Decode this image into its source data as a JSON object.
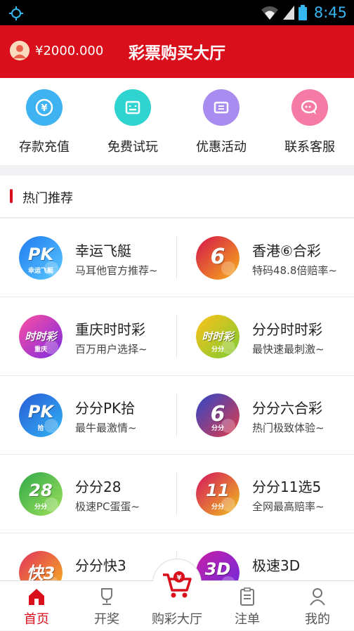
{
  "status": {
    "time": "8:45"
  },
  "header": {
    "balance": "¥2000.000",
    "title": "彩票购买大厅"
  },
  "quick_actions": [
    {
      "label": "存款充值",
      "color": "#3fb2f1",
      "icon": "yen-deposit-icon"
    },
    {
      "label": "免费试玩",
      "color": "#2fd3cf",
      "icon": "controller-icon"
    },
    {
      "label": "优惠活动",
      "color": "#a98cf0",
      "icon": "ticket-icon"
    },
    {
      "label": "联系客服",
      "color": "#f57aa5",
      "icon": "chat-icon"
    }
  ],
  "section": {
    "title": "热门推荐"
  },
  "games": [
    {
      "name": "幸运飞艇",
      "desc": "马耳他官方推荐~",
      "icon_text": "PK",
      "icon_sub": "幸运飞艇",
      "colors": [
        "#1f7bf0",
        "#5ac8ff"
      ]
    },
    {
      "name": "香港⑥合彩",
      "desc": "特码48.8倍赔率~",
      "icon_text": "6",
      "icon_sub": "",
      "colors": [
        "#d4124a",
        "#f7b21a"
      ]
    },
    {
      "name": "重庆时时彩",
      "desc": "百万用户选择~",
      "icon_text": "时时彩",
      "icon_sub": "重庆",
      "colors": [
        "#ff4fa3",
        "#7a2be0"
      ]
    },
    {
      "name": "分分时时彩",
      "desc": "最快速最刺激~",
      "icon_text": "时时彩",
      "icon_sub": "分分",
      "colors": [
        "#ffc21c",
        "#7acb30"
      ]
    },
    {
      "name": "分分PK拾",
      "desc": "最牛最激情~",
      "icon_text": "PK",
      "icon_sub": "拾",
      "colors": [
        "#2a5cd8",
        "#2fb2f2"
      ]
    },
    {
      "name": "分分六合彩",
      "desc": "热门极致体验~",
      "icon_text": "6",
      "icon_sub": "分分",
      "colors": [
        "#2d47c8",
        "#e23b4a"
      ]
    },
    {
      "name": "分分28",
      "desc": "极速PC蛋蛋~",
      "icon_text": "28",
      "icon_sub": "分分",
      "colors": [
        "#31a94a",
        "#9ee05a"
      ]
    },
    {
      "name": "分分11选5",
      "desc": "全网最高赔率~",
      "icon_text": "11",
      "icon_sub": "分分",
      "colors": [
        "#d4125e",
        "#f0c21c"
      ]
    },
    {
      "name": "分分快3",
      "desc": "",
      "icon_text": "快3",
      "icon_sub": "",
      "colors": [
        "#e2315c",
        "#f6b61c"
      ]
    },
    {
      "name": "极速3D",
      "desc": "",
      "icon_text": "3D",
      "icon_sub": "",
      "colors": [
        "#c81fa6",
        "#6a2be0"
      ]
    }
  ],
  "tabs": [
    {
      "label": "首页",
      "icon": "home-icon",
      "active": true
    },
    {
      "label": "开奖",
      "icon": "trophy-icon",
      "active": false
    },
    {
      "label": "购彩大厅",
      "icon": "cart-icon",
      "active": false
    },
    {
      "label": "注单",
      "icon": "clipboard-icon",
      "active": false
    },
    {
      "label": "我的",
      "icon": "user-icon",
      "active": false
    }
  ],
  "accent": "#d90f1c"
}
